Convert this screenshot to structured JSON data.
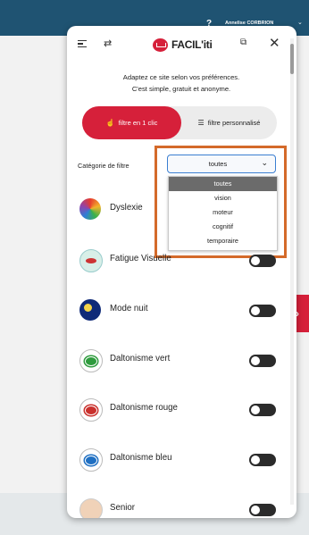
{
  "topbar": {
    "help_icon": "?",
    "user_name": "Annelise CORBRION",
    "chevron": "⌄"
  },
  "panel": {
    "header": {
      "logo_text": "FACIL'iti",
      "close_icon": "✕"
    },
    "intro_line1": "Adaptez ce site selon vos préférences.",
    "intro_line2": "C'est simple, gratuit et anonyme.",
    "modes": {
      "mode_one_click": "filtre en 1 clic",
      "mode_custom": "filtre personnalisé"
    },
    "category": {
      "label": "Catégorie de filtre",
      "selected": "toutes",
      "options": [
        "toutes",
        "vision",
        "moteur",
        "cognitif",
        "temporaire"
      ]
    },
    "filters": [
      {
        "label": "Dyslexie",
        "enabled": false
      },
      {
        "label": "Fatigue Visuelle",
        "enabled": false
      },
      {
        "label": "Mode nuit",
        "enabled": false
      },
      {
        "label": "Daltonisme vert",
        "enabled": false
      },
      {
        "label": "Daltonisme rouge",
        "enabled": false
      },
      {
        "label": "Daltonisme bleu",
        "enabled": false
      },
      {
        "label": "Senior",
        "enabled": false
      }
    ],
    "colors": {
      "accent": "#d6203a",
      "highlight": "#d46a2a",
      "header_bar": "#1f5372"
    }
  }
}
